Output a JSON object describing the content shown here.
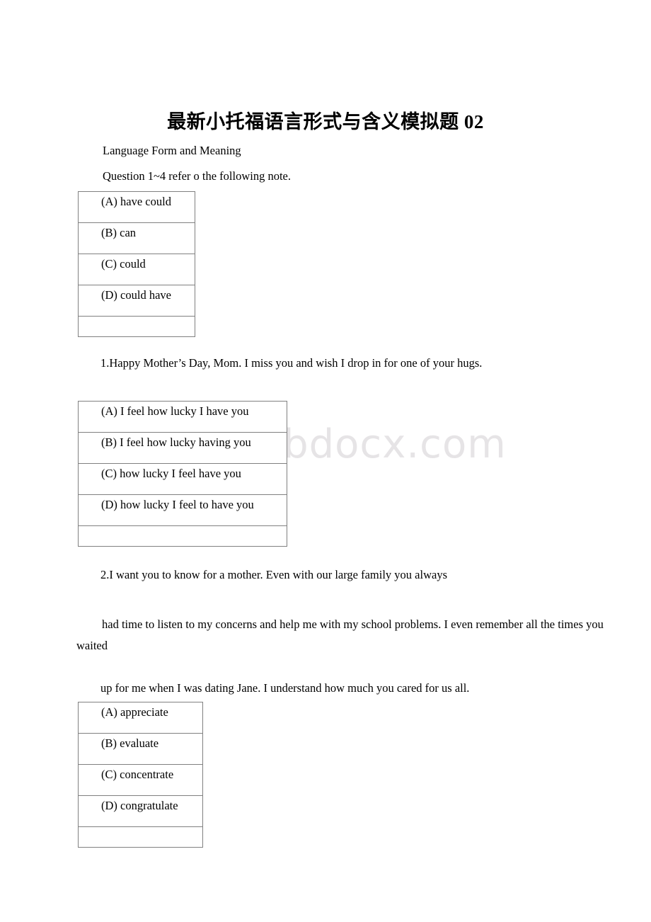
{
  "document": {
    "title": "最新小托福语言形式与含义模拟题 02",
    "watermark": "www.bdocx.com",
    "section_heading": "Language Form and Meaning",
    "instruction": "Question 1~4 refer o the following note."
  },
  "questions": [
    {
      "id": "q1-stem",
      "text": "1.Happy Mother’s Day, Mom. I miss you and wish I drop in for one of your hugs."
    },
    {
      "id": "q2-stem-line1",
      "text": "2.I want you to know for a mother. Even with our large family you always"
    },
    {
      "id": "q2-stem-line2",
      "text": "had time to listen to my concerns and help me with my school problems. I even remember all the times you waited"
    },
    {
      "id": "q2-stem-line3",
      "text": "up for me when I was dating Jane. I understand how much you cared for us all."
    }
  ],
  "tables": [
    {
      "id": "table-1",
      "options": [
        "(A) have could",
        "(B) can",
        "(C) could",
        "(D) could have",
        ""
      ]
    },
    {
      "id": "table-2",
      "options": [
        "(A) I feel how lucky I have you",
        "(B) I feel how lucky having you",
        "(C) how lucky I feel have you",
        "(D) how lucky I feel to have you",
        ""
      ]
    },
    {
      "id": "table-3",
      "options": [
        "(A) appreciate",
        "(B) evaluate",
        "(C) concentrate",
        "(D) congratulate",
        ""
      ]
    }
  ],
  "colors": {
    "text": "#000000",
    "page_background": "#ffffff",
    "table_border": "#808080",
    "watermark": "#e6e4e6"
  }
}
